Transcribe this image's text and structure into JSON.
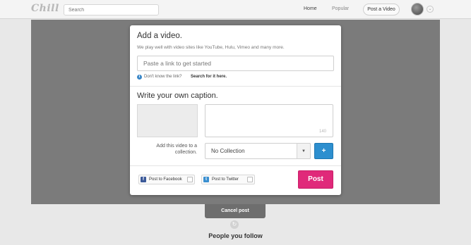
{
  "nav": {
    "logo": "Chill",
    "search_placeholder": "Search",
    "home": "Home",
    "popular": "Popular",
    "post_video": "Post a Video",
    "menu_caret": "⌄"
  },
  "modal": {
    "add_title": "Add a video.",
    "add_subtitle": "We play well with video sites like YouTube, Hulu, Vimeo and many more.",
    "link_placeholder": "Paste a link to get started",
    "info_icon": "i",
    "help_text": "Don't know the link?",
    "help_link": "Search for it here.",
    "caption_title": "Write your own caption.",
    "char_count": "140",
    "collection_label": "Add this video to a collection.",
    "collection_value": "No Collection",
    "collection_caret": "▼",
    "add_collection": "+",
    "share_facebook": "Post to Facebook",
    "share_twitter": "Post to Twitter",
    "post_button": "Post"
  },
  "footer": {
    "cancel_post": "Cancel post",
    "refresh_icon": "↻",
    "people_you_follow": "People you follow"
  },
  "colors": {
    "overlay": "#7b7b7b",
    "post_pink": "#e0297a",
    "add_blue": "#2d8fcf",
    "facebook": "#3b5998",
    "twitter": "#3a8fd0"
  }
}
